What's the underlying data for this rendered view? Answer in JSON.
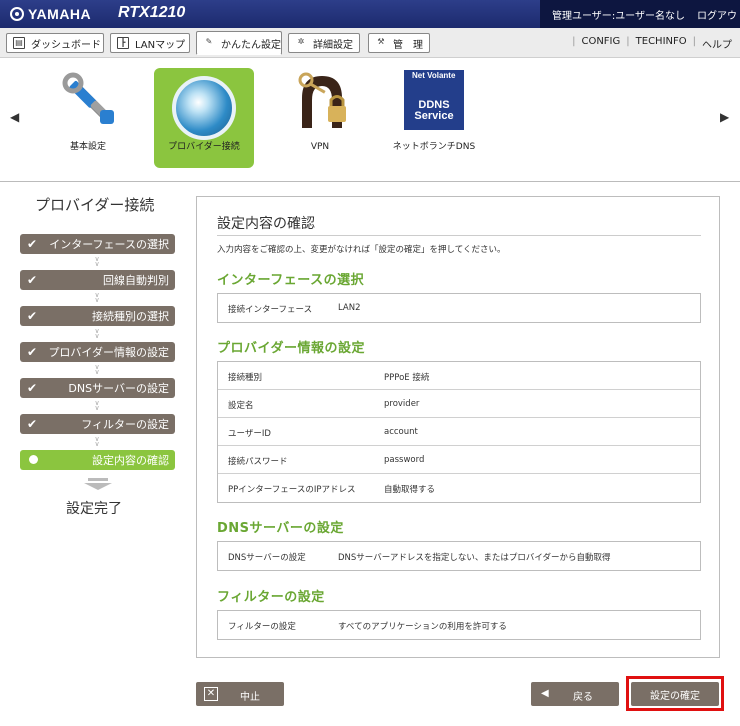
{
  "header": {
    "brand": "YAMAHA",
    "model": "RTX1210",
    "user_label": "管理ユーザー",
    "user_name": "ユーザー名なし",
    "logout": "ログアウト"
  },
  "menu": {
    "tabs": [
      {
        "label": "ダッシュボード",
        "icon": "dashboard-icon"
      },
      {
        "label": "LANマップ",
        "icon": "lan-map-icon"
      },
      {
        "label": "かんたん設定",
        "icon": "easy-setup-icon"
      },
      {
        "label": "詳細設定",
        "icon": "gear-icon"
      },
      {
        "label": "管　理",
        "icon": "wrench-icon"
      }
    ],
    "links": [
      "CONFIG",
      "TECHINFO",
      "ヘルプ"
    ]
  },
  "icons": [
    {
      "label": "基本設定",
      "icon": "tools-icon"
    },
    {
      "label": "プロバイダー接続",
      "icon": "globe-icon"
    },
    {
      "label": "VPN",
      "icon": "keys-lock-icon"
    },
    {
      "label": "ネットボランチDNS",
      "icon": "ddns-icon",
      "badge_top": "Net Volante",
      "badge_bottom": "DDNS Service"
    }
  ],
  "sidebar": {
    "title": "プロバイダー接続",
    "steps": [
      "インターフェースの選択",
      "回線自動判別",
      "接続種別の選択",
      "プロバイダー情報の設定",
      "DNSサーバーの設定",
      "フィルターの設定",
      "設定内容の確認"
    ],
    "finish": "設定完了"
  },
  "panel": {
    "title": "設定内容の確認",
    "description": "入力内容をご確認の上、変更がなければ「設定の確定」を押してください。",
    "sections": [
      {
        "title": "インターフェースの選択",
        "rows": [
          [
            "接続インターフェース",
            "LAN2"
          ]
        ]
      },
      {
        "title": "プロバイダー情報の設定",
        "rows": [
          [
            "接続種別",
            "PPPoE 接続"
          ],
          [
            "設定名",
            "provider"
          ],
          [
            "ユーザーID",
            "account"
          ],
          [
            "接続パスワード",
            "password"
          ],
          [
            "PPインターフェースのIPアドレス",
            "自動取得する"
          ]
        ]
      },
      {
        "title": "DNSサーバーの設定",
        "rows": [
          [
            "DNSサーバーの設定",
            "DNSサーバーアドレスを指定しない、またはプロバイダーから自動取得"
          ]
        ]
      },
      {
        "title": "フィルターの設定",
        "rows": [
          [
            "フィルターの設定",
            "すべてのアプリケーションの利用を許可する"
          ]
        ]
      }
    ]
  },
  "buttons": {
    "cancel": "中止",
    "back": "戻る",
    "confirm": "設定の確定"
  },
  "colors": {
    "accent_green": "#8bc53f",
    "section_green": "#6aa733",
    "step_gray": "#7a6f66",
    "header_blue": "#1c2a6e",
    "highlight_red": "#e01010"
  }
}
